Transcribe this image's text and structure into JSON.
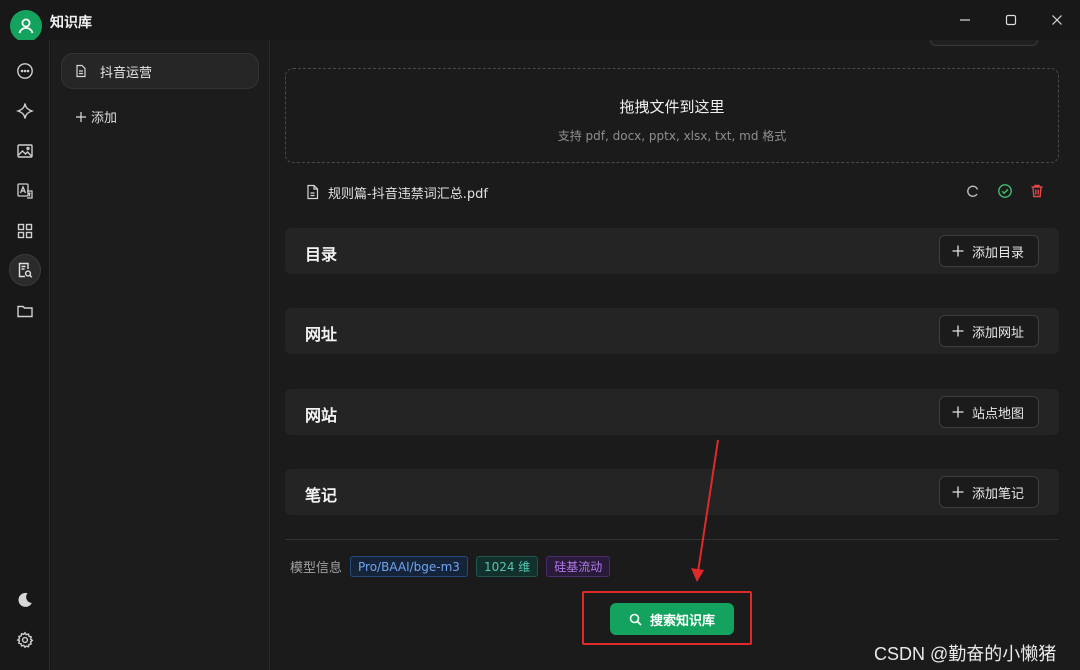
{
  "window": {
    "title": "知识库",
    "controls": {
      "minimize": "minimize-icon",
      "maximize": "maximize-icon",
      "close": "close-icon"
    }
  },
  "rail": {
    "icons": [
      "chat-icon",
      "assistant-sparkle-icon",
      "image-icon",
      "translate-icon",
      "apps-grid-icon",
      "knowledge-search-icon",
      "folder-icon",
      "moon-icon",
      "settings-gear-icon"
    ],
    "active": "knowledge-search-icon"
  },
  "sidebar": {
    "items": [
      {
        "label": "抖音运营",
        "icon": "document-icon",
        "selected": true
      }
    ],
    "add_label": "添加"
  },
  "main": {
    "dropzone": {
      "title": "拖拽文件到这里",
      "subtitle": "支持 pdf, docx, pptx, xlsx, txt, md 格式"
    },
    "file": {
      "name": "规则篇-抖音违禁词汇总.pdf",
      "actions": [
        "refresh-icon",
        "check-circle-icon",
        "trash-icon"
      ]
    },
    "sections": [
      {
        "title": "目录",
        "button": "添加目录"
      },
      {
        "title": "网址",
        "button": "添加网址"
      },
      {
        "title": "网站",
        "button": "站点地图"
      },
      {
        "title": "笔记",
        "button": "添加笔记"
      }
    ],
    "model_info": {
      "label": "模型信息",
      "tags": [
        "Pro/BAAI/bge-m3",
        "1024 维",
        "硅基流动"
      ]
    },
    "search_button": "搜索知识库"
  },
  "watermark": "CSDN @勤奋的小懒猪",
  "colors": {
    "accent": "#13a35e",
    "annotation": "#e02a2a",
    "danger": "#e04848",
    "success": "#3fbf6f"
  }
}
